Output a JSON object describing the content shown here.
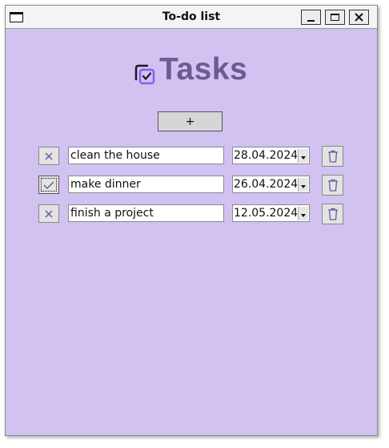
{
  "window": {
    "title": "To-do list"
  },
  "header": {
    "title": "Tasks"
  },
  "toolbar": {
    "add_label": "+"
  },
  "tasks": [
    {
      "text": "clean the house",
      "date": "28.04.2024",
      "done": false
    },
    {
      "text": "make dinner",
      "date": "26.04.2024",
      "done": true
    },
    {
      "text": "finish a project",
      "date": "12.05.2024",
      "done": false
    }
  ],
  "icons": {
    "window": "window-icon",
    "minimize": "minimize-icon",
    "maximize": "maximize-icon",
    "close": "close-icon",
    "logo": "checkbox-logo-icon",
    "not_done": "x-icon",
    "done": "check-icon",
    "delete": "trash-icon",
    "date_dropdown": "chevron-down-icon"
  },
  "colors": {
    "background": "#d1c2f2",
    "heading": "#6e5a93",
    "accent": "#8a5cf5"
  }
}
